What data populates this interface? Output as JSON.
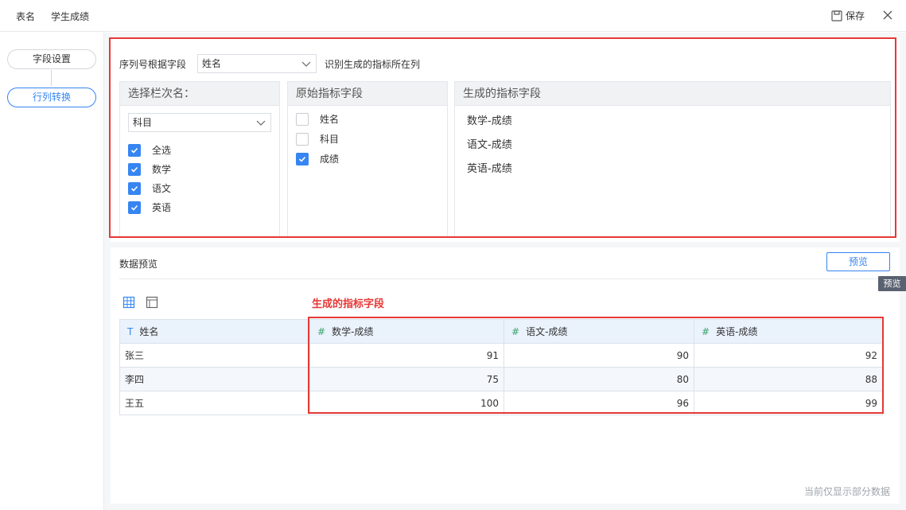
{
  "header": {
    "table_name_label": "表名",
    "table_name_value": "学生成绩",
    "save_label": "保存"
  },
  "sidebar": {
    "steps": [
      {
        "label": "字段设置",
        "active": false
      },
      {
        "label": "行列转换",
        "active": true
      }
    ]
  },
  "config": {
    "sequence_label": "序列号根据字段",
    "sequence_value": "姓名",
    "sequence_note": "识别生成的指标所在列",
    "column_panel": {
      "title": "选择栏次名：",
      "select_value": "科目",
      "options": [
        {
          "label": "全选",
          "checked": true
        },
        {
          "label": "数学",
          "checked": true
        },
        {
          "label": "语文",
          "checked": true
        },
        {
          "label": "英语",
          "checked": true
        }
      ]
    },
    "source_panel": {
      "title": "原始指标字段",
      "options": [
        {
          "label": "姓名",
          "checked": false
        },
        {
          "label": "科目",
          "checked": false
        },
        {
          "label": "成绩",
          "checked": true
        }
      ]
    },
    "generated_panel": {
      "title": "生成的指标字段",
      "items": [
        "数学-成绩",
        "语文-成绩",
        "英语-成绩"
      ]
    }
  },
  "preview": {
    "title": "数据预览",
    "button_label": "预览",
    "tooltip": "预览",
    "annotation": "生成的指标字段",
    "columns": [
      {
        "type": "T",
        "label": "姓名"
      },
      {
        "type": "#",
        "label": "数学-成绩"
      },
      {
        "type": "#",
        "label": "语文-成绩"
      },
      {
        "type": "#",
        "label": "英语-成绩"
      }
    ],
    "rows": [
      [
        "张三",
        "91",
        "90",
        "92"
      ],
      [
        "李四",
        "75",
        "80",
        "88"
      ],
      [
        "王五",
        "100",
        "96",
        "99"
      ]
    ],
    "footnote": "当前仅显示部分数据"
  },
  "colors": {
    "accent": "#3685f2",
    "highlight_border": "#e53935"
  }
}
